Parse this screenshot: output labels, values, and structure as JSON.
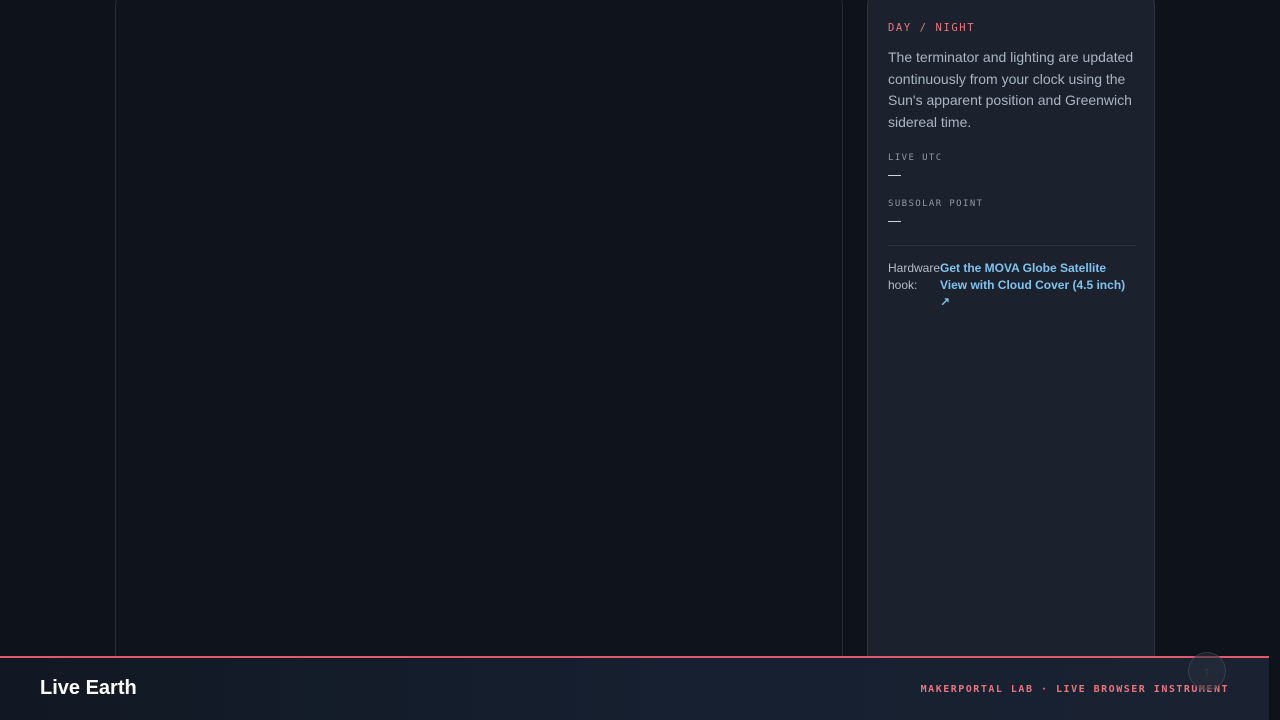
{
  "panel": {
    "kicker": "DAY / NIGHT",
    "description": "The terminator and lighting are updated continuously from your clock using the Sun's apparent position and Greenwich sidereal time.",
    "live_utc_label": "LIVE UTC",
    "live_utc_value": "—",
    "subsolar_label": "SUBSOLAR POINT",
    "subsolar_value": "—",
    "hook_label": "Hardware hook:",
    "hook_link": "Get the MOVA Globe Satellite View with Cloud Cover (4.5 inch) ↗"
  },
  "footer": {
    "brand": "Live Earth",
    "tagline": "MAKERPORTAL LAB · LIVE BROWSER INSTRUMENT"
  },
  "icons": {
    "scroll_top": "arrow-up-icon"
  },
  "colors": {
    "accent": "#e8757e",
    "link": "#7ec3ee",
    "footer_rule": "#e05a6b"
  }
}
